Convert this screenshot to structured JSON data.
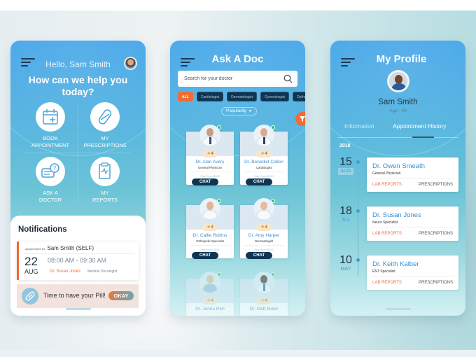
{
  "home": {
    "greeting": "Hello, Sam Smith",
    "headline": "How can we help you today?",
    "actions": [
      {
        "label_line1": "BOOK",
        "label_line2": "APPOINTMENT",
        "icon": "calendar-add-icon"
      },
      {
        "label_line1": "MY",
        "label_line2": "PRESCRIPTIONS",
        "icon": "pill-icon"
      },
      {
        "label_line1": "ASK A",
        "label_line2": "DOCTOR",
        "icon": "chat-question-icon"
      },
      {
        "label_line1": "MY",
        "label_line2": "REPORTS",
        "icon": "report-clipboard-icon"
      }
    ],
    "notifications": {
      "title": "Notifications",
      "appointment": {
        "for_label": "Appointment for:",
        "patient": "Sam Smith (SELF)",
        "day": "22",
        "month": "AUG",
        "time": "08:00 AM - 09:30 AM",
        "doctor": "Dr. Susan Jones",
        "specialty": "Medical Oncologist"
      },
      "reminder": {
        "text": "Time to have your Pill!",
        "button": "OKAY"
      }
    }
  },
  "ask_doc": {
    "title": "Ask A Doc",
    "search_placeholder": "Search for your doctor",
    "chips": [
      "ALL",
      "Cardiologist",
      "Dermatologist",
      "Gynecologist",
      "Opthalmologist"
    ],
    "sort_label": "Popularity",
    "chat_label": "CHAT",
    "doctors": [
      {
        "name": "Dr. Alan Avery",
        "specialty": "General Physician",
        "rating": "4",
        "price": "Start from $200",
        "online": true
      },
      {
        "name": "Dr. Benedict Collen",
        "specialty": "Cardiologist",
        "rating": "4",
        "price": "Start from $200",
        "online": true
      },
      {
        "name": "Dr. Callie Robins",
        "specialty": "Orthopedic Specialist",
        "rating": "4",
        "price": "Start from $200",
        "online": true
      },
      {
        "name": "Dr. Amy Harper",
        "specialty": "Dermatologist",
        "rating": "4",
        "price": "Start from $200",
        "online": true
      },
      {
        "name": "Dr. Jenna Ren",
        "specialty": "",
        "rating": "4",
        "price": "",
        "online": true
      },
      {
        "name": "Dr. Matt Muler",
        "specialty": "",
        "rating": "4",
        "price": "",
        "online": true
      }
    ]
  },
  "profile": {
    "title": "My Profile",
    "name": "Sam Smith",
    "age": "Age : 40",
    "tabs": [
      "Information",
      "Appointment History"
    ],
    "active_tab": "Appointment History",
    "year": "2018",
    "history": [
      {
        "day": "15",
        "month": "AUG",
        "doctor": "Dr. Owen Smeath",
        "specialty": "General Physician",
        "lab": "LAB REPORTS",
        "rx": "PRESCRIPTIONS"
      },
      {
        "day": "18",
        "month": "JUL",
        "doctor": "Dr. Susan Jones",
        "specialty": "Neuro Specialist",
        "lab": "LAB REPORTS",
        "rx": "PRESCRIPTIONS"
      },
      {
        "day": "10",
        "month": "MAY",
        "doctor": "Dr. Keith Kalber",
        "specialty": "ENT Specialist",
        "lab": "LAB REPORTS",
        "rx": "PRESCRIPTIONS"
      }
    ]
  },
  "colors": {
    "accent_orange": "#ee6d35",
    "navy": "#0f3553",
    "link_blue": "#3a8fd0",
    "online_green": "#2ec26a"
  }
}
